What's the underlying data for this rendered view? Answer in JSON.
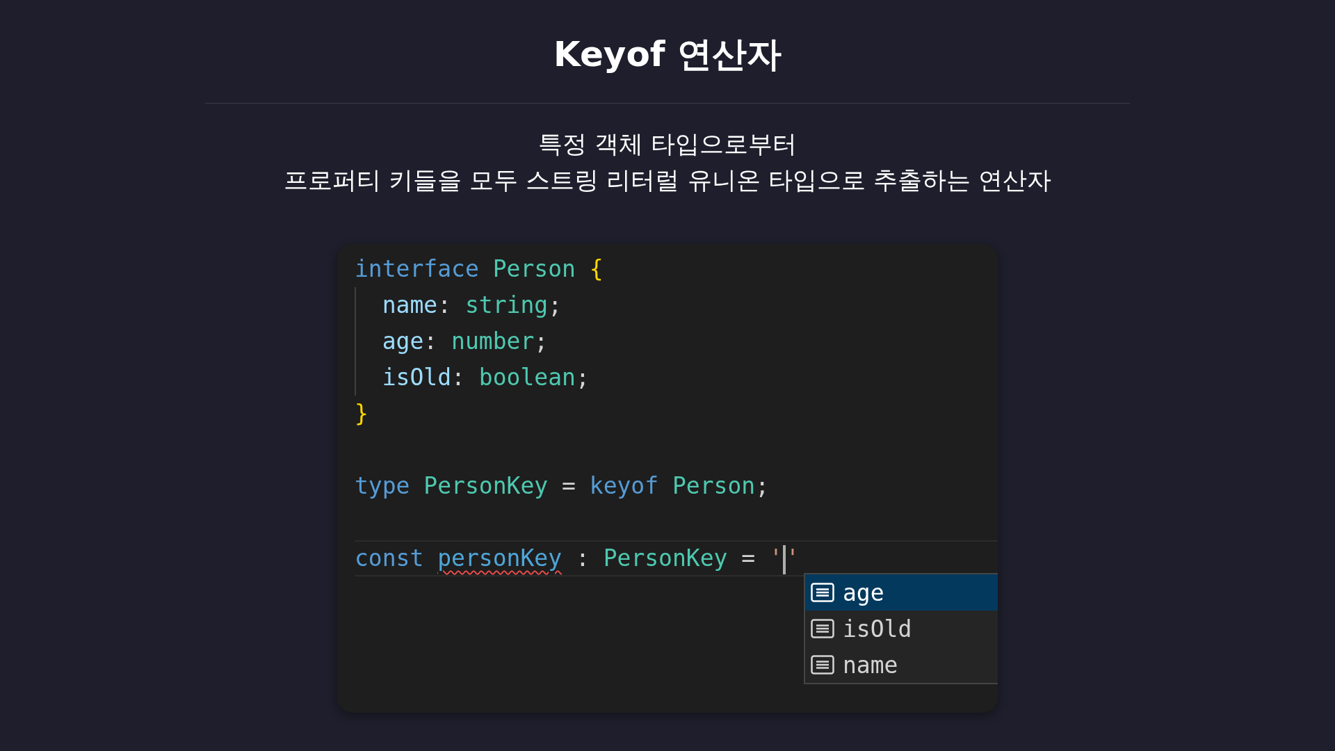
{
  "title": "Keyof 연산자",
  "subtitle": [
    "특정 객체 타입으로부터",
    "프로퍼티 키들을 모두 스트링 리터럴 유니온 타입으로 추출하는 연산자"
  ],
  "code": {
    "lines": [
      {
        "kind": "code",
        "in_block": false,
        "current": false,
        "tokens": [
          {
            "kind": "keyword",
            "text": "interface "
          },
          {
            "kind": "type",
            "text": "Person "
          },
          {
            "kind": "brace",
            "text": "{"
          }
        ]
      },
      {
        "kind": "code",
        "in_block": true,
        "current": false,
        "tokens": [
          {
            "kind": "property",
            "text": "  name"
          },
          {
            "kind": "plain",
            "text": ": "
          },
          {
            "kind": "type",
            "text": "string"
          },
          {
            "kind": "plain",
            "text": ";"
          }
        ]
      },
      {
        "kind": "code",
        "in_block": true,
        "current": false,
        "tokens": [
          {
            "kind": "property",
            "text": "  age"
          },
          {
            "kind": "plain",
            "text": ": "
          },
          {
            "kind": "type",
            "text": "number"
          },
          {
            "kind": "plain",
            "text": ";"
          }
        ]
      },
      {
        "kind": "code",
        "in_block": true,
        "current": false,
        "tokens": [
          {
            "kind": "property",
            "text": "  isOld"
          },
          {
            "kind": "plain",
            "text": ": "
          },
          {
            "kind": "type",
            "text": "boolean"
          },
          {
            "kind": "plain",
            "text": ";"
          }
        ]
      },
      {
        "kind": "code",
        "in_block": false,
        "current": false,
        "tokens": [
          {
            "kind": "brace",
            "text": "}"
          }
        ]
      },
      {
        "kind": "blank"
      },
      {
        "kind": "code",
        "in_block": false,
        "current": false,
        "tokens": [
          {
            "kind": "keyword",
            "text": "type "
          },
          {
            "kind": "type",
            "text": "PersonKey"
          },
          {
            "kind": "plain",
            "text": " = "
          },
          {
            "kind": "keyword",
            "text": "keyof "
          },
          {
            "kind": "type",
            "text": "Person"
          },
          {
            "kind": "plain",
            "text": ";"
          }
        ]
      },
      {
        "kind": "blank"
      },
      {
        "kind": "code",
        "in_block": false,
        "current": true,
        "tokens": [
          {
            "kind": "keyword",
            "text": "const "
          },
          {
            "kind": "variable",
            "text": "personKey",
            "error": true
          },
          {
            "kind": "plain",
            "text": " : "
          },
          {
            "kind": "type",
            "text": "PersonKey"
          },
          {
            "kind": "plain",
            "text": " = "
          },
          {
            "kind": "string",
            "text": "'"
          },
          {
            "kind": "caret"
          },
          {
            "kind": "string",
            "text": "'"
          }
        ]
      }
    ],
    "suggestions": [
      {
        "label": "age",
        "selected": true
      },
      {
        "label": "isOld",
        "selected": false
      },
      {
        "label": "name",
        "selected": false
      }
    ]
  }
}
